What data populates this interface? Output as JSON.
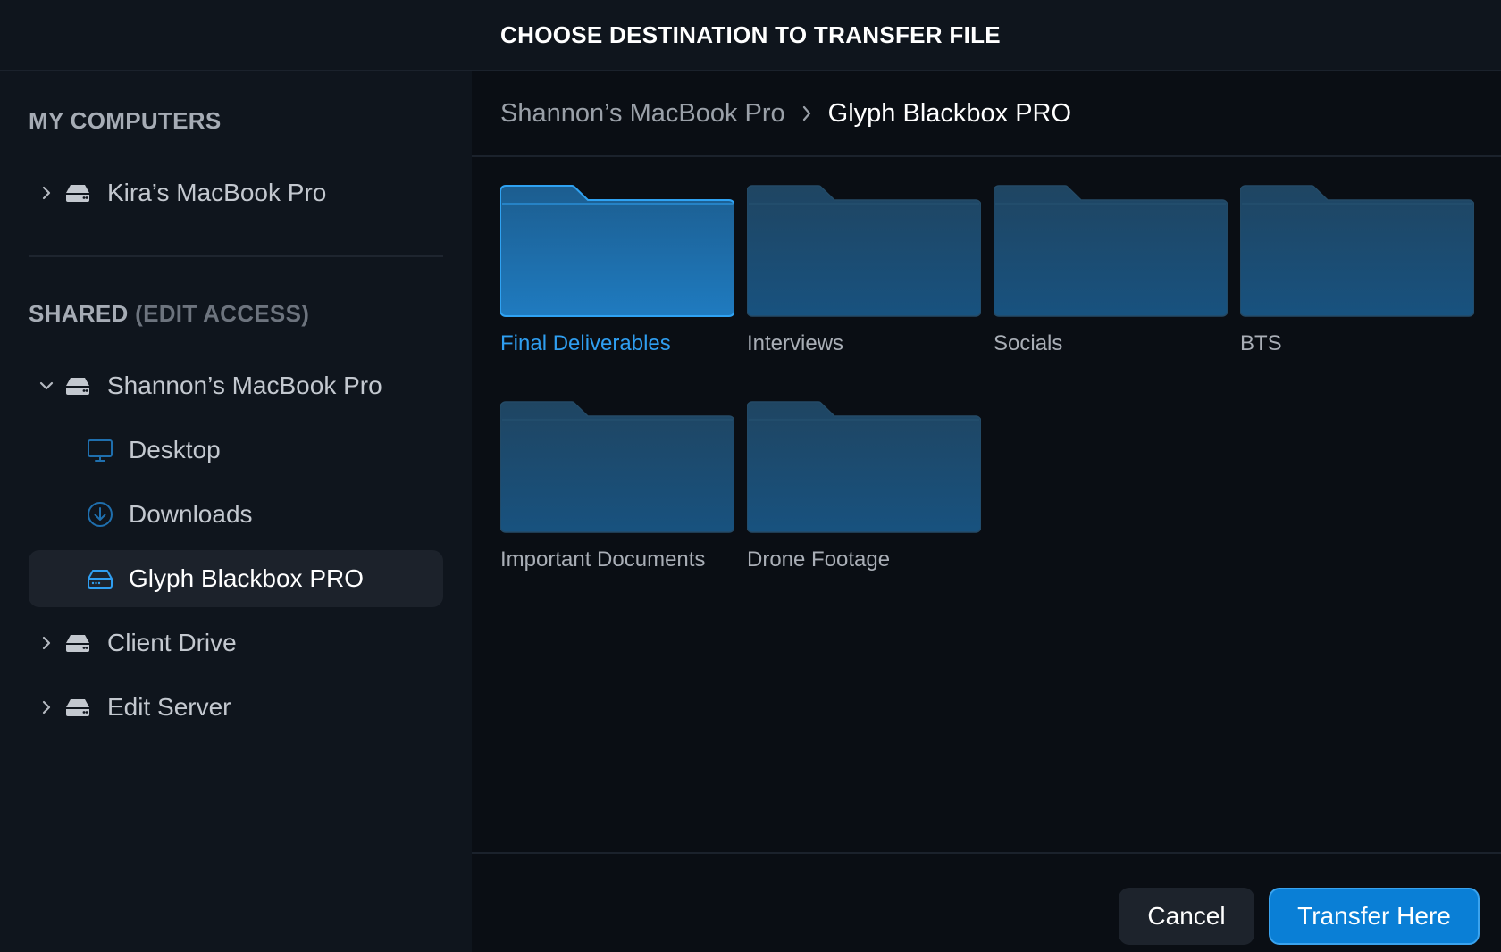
{
  "dialog": {
    "title": "CHOOSE DESTINATION TO TRANSFER FILE"
  },
  "sidebar": {
    "my_computers": {
      "header": "MY COMPUTERS",
      "items": [
        {
          "label": "Kira’s MacBook Pro",
          "icon": "drive-icon",
          "expanded": false
        }
      ]
    },
    "shared": {
      "header": "SHARED",
      "header_sub": "(EDIT ACCESS)",
      "items": [
        {
          "label": "Shannon’s MacBook Pro",
          "icon": "drive-icon",
          "expanded": true
        },
        {
          "label": "Desktop",
          "icon": "monitor-icon"
        },
        {
          "label": "Downloads",
          "icon": "download-icon"
        },
        {
          "label": "Glyph Blackbox PRO",
          "icon": "external-drive-icon",
          "selected": true
        },
        {
          "label": "Client Drive",
          "icon": "drive-icon",
          "expanded": false
        },
        {
          "label": "Edit Server",
          "icon": "drive-icon",
          "expanded": false
        }
      ]
    }
  },
  "breadcrumb": {
    "parent": "Shannon’s MacBook Pro",
    "current": "Glyph Blackbox PRO"
  },
  "folders": [
    {
      "label": "Final Deliverables",
      "selected": true
    },
    {
      "label": "Interviews"
    },
    {
      "label": "Socials"
    },
    {
      "label": "BTS"
    },
    {
      "label": "Important Documents"
    },
    {
      "label": "Drone Footage"
    }
  ],
  "buttons": {
    "cancel": "Cancel",
    "transfer": "Transfer Here"
  },
  "colors": {
    "accent": "#0a7fd6",
    "selected_text": "#2f9ef0",
    "background": "#0b1017",
    "sidebar": "#0f151d"
  }
}
